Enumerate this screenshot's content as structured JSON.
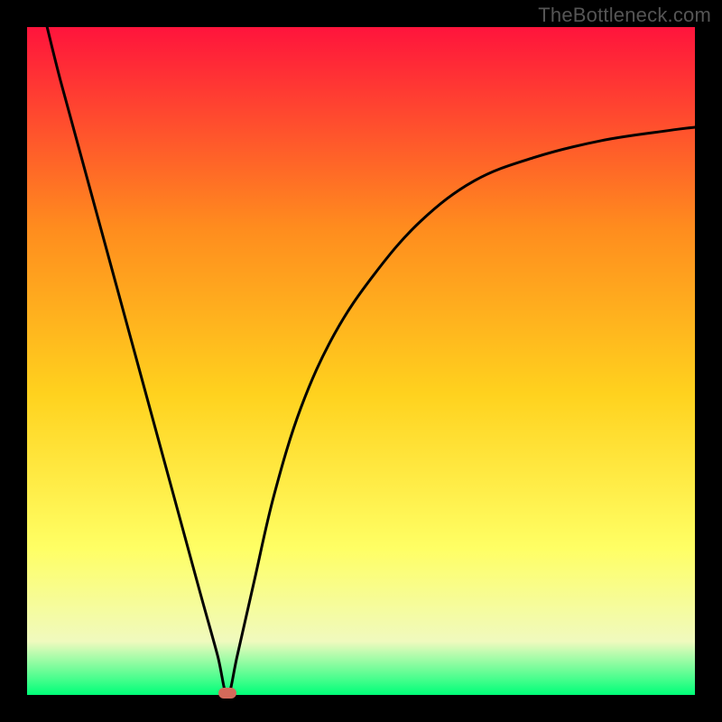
{
  "watermark": "TheBottleneck.com",
  "chart_data": {
    "type": "line",
    "title": "",
    "xlabel": "",
    "ylabel": "",
    "xlim": [
      0,
      100
    ],
    "ylim": [
      0,
      100
    ],
    "grid": false,
    "legend": false,
    "background_gradient": {
      "top": "#ff143c",
      "mid_upper": "#ff8c1e",
      "mid": "#ffd21e",
      "mid_lower": "#ffff64",
      "near_bottom": "#f0fabe",
      "bottom": "#00ff78"
    },
    "accent_point": {
      "x": 30,
      "y": 0,
      "color": "#d46a5a"
    },
    "series": [
      {
        "name": "curve",
        "x": [
          3,
          5,
          8,
          11,
          14,
          17,
          20,
          23,
          26,
          28.5,
          30,
          31.5,
          34,
          37,
          41,
          46,
          52,
          59,
          67,
          76,
          86,
          96,
          100
        ],
        "y": [
          100,
          92,
          81,
          70,
          59,
          48,
          37,
          26,
          15,
          6,
          0,
          6,
          17,
          30,
          43,
          54,
          63,
          71,
          77,
          80.5,
          83,
          84.5,
          85
        ]
      }
    ]
  }
}
